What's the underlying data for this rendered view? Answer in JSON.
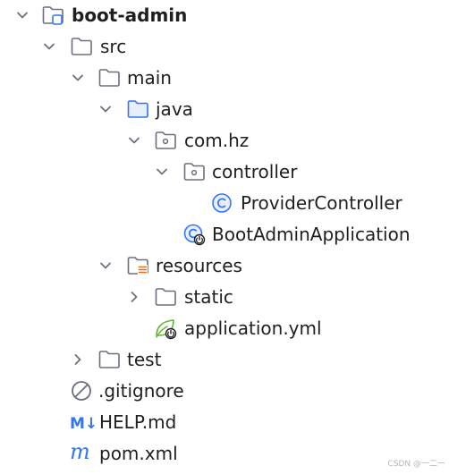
{
  "tree": {
    "root": {
      "label": "boot-admin",
      "icon": "module-folder-icon",
      "expanded": true
    },
    "src": {
      "label": "src",
      "icon": "folder-icon",
      "expanded": true
    },
    "main": {
      "label": "main",
      "icon": "folder-icon",
      "expanded": true
    },
    "java": {
      "label": "java",
      "icon": "source-folder-icon",
      "expanded": true
    },
    "com_hz": {
      "label": "com.hz",
      "icon": "package-icon",
      "expanded": true
    },
    "controller": {
      "label": "controller",
      "icon": "package-icon",
      "expanded": true
    },
    "provider_controller": {
      "label": "ProviderController",
      "icon": "java-class-icon"
    },
    "boot_admin_app": {
      "label": "BootAdminApplication",
      "icon": "spring-boot-class-icon"
    },
    "resources": {
      "label": "resources",
      "icon": "resources-folder-icon",
      "expanded": true
    },
    "static": {
      "label": "static",
      "icon": "folder-icon",
      "expanded": false
    },
    "application_yml": {
      "label": "application.yml",
      "icon": "spring-config-icon"
    },
    "test": {
      "label": "test",
      "icon": "folder-icon",
      "expanded": false
    },
    "gitignore": {
      "label": ".gitignore",
      "icon": "ignored-file-icon"
    },
    "help_md": {
      "label": "HELP.md",
      "icon": "markdown-icon",
      "icon_text": "M↓"
    },
    "pom_xml": {
      "label": "pom.xml",
      "icon": "maven-icon",
      "icon_text": "m"
    }
  },
  "watermark": "CSDN @一二ー",
  "colors": {
    "text": "#1f1f1f",
    "chevron": "#6c707e",
    "folder_stroke": "#6c707e",
    "source_folder": "#3574f0",
    "java_class": "#3574f0",
    "spring": "#5fb832",
    "resources_lines": "#e66d17",
    "maven": "#3574f0"
  }
}
